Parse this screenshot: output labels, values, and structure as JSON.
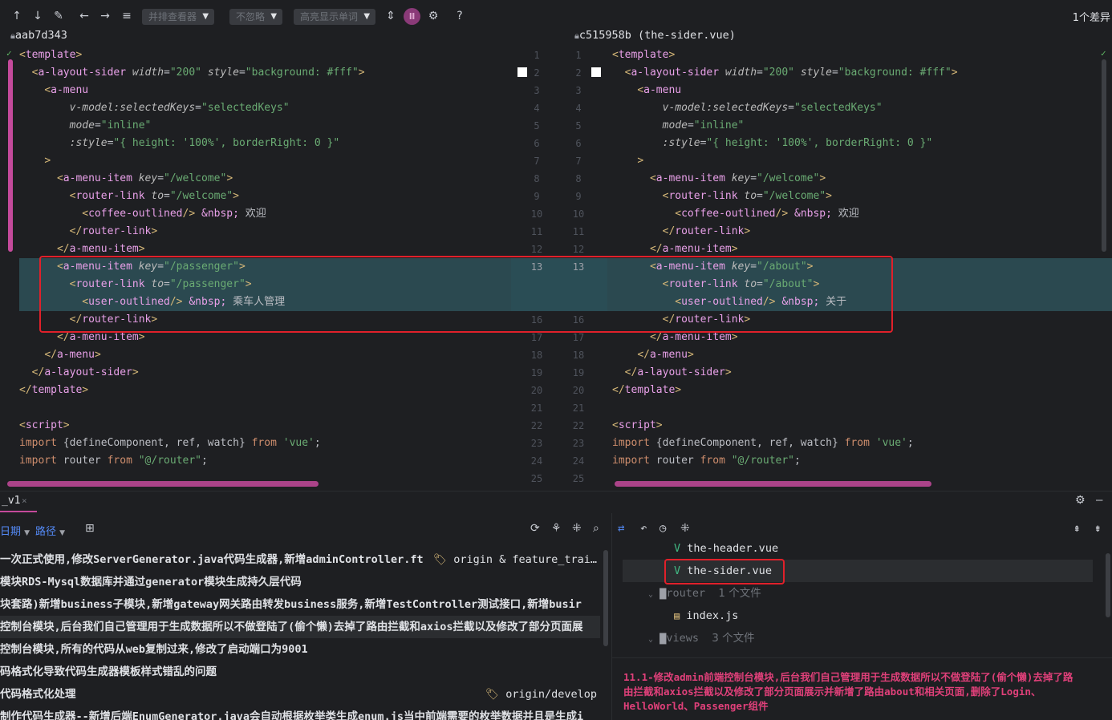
{
  "toolbar": {
    "viewer_label": "并排查看器",
    "ignore_label": "不忽略",
    "highlight_label": "高亮显示单词",
    "diff_count": "1个差异",
    "help": "?"
  },
  "left_panel": {
    "title": "aab7d343"
  },
  "right_panel": {
    "title": "c515958b (the-sider.vue)"
  },
  "code": {
    "left": [
      [
        "<template>"
      ],
      [
        "  <a-layout-sider width=\"200\" style=\"background: #fff\">"
      ],
      [
        "    <a-menu"
      ],
      [
        "        v-model:selectedKeys=\"selectedKeys\""
      ],
      [
        "        mode=\"inline\""
      ],
      [
        "        :style=\"{ height: '100%', borderRight: 0 }\""
      ],
      [
        "    >"
      ],
      [
        "      <a-menu-item key=\"/welcome\">"
      ],
      [
        "        <router-link to=\"/welcome\">"
      ],
      [
        "          <coffee-outlined/> &nbsp; 欢迎"
      ],
      [
        "        </router-link>"
      ],
      [
        "      </a-menu-item>"
      ],
      [
        "      <a-menu-item key=\"/passenger\">"
      ],
      [
        "        <router-link to=\"/passenger\">"
      ],
      [
        "          <user-outlined/> &nbsp; 乘车人管理"
      ],
      [
        "        </router-link>"
      ],
      [
        "      </a-menu-item>"
      ],
      [
        "    </a-menu>"
      ],
      [
        "  </a-layout-sider>"
      ],
      [
        "</template>"
      ],
      [
        ""
      ],
      [
        "<script>"
      ],
      [
        "import {defineComponent, ref, watch} from 'vue';"
      ],
      [
        "import router from \"@/router\";"
      ]
    ],
    "right_changed": [
      "      <a-menu-item key=\"/about\">",
      "        <router-link to=\"/about\">",
      "          <user-outlined/> &nbsp; 关于"
    ],
    "line_numbers_left": [
      "1",
      "2",
      "3",
      "4",
      "5",
      "6",
      "7",
      "8",
      "9",
      "10",
      "11",
      "12",
      "13",
      "",
      "",
      "16",
      "17",
      "18",
      "19",
      "20",
      "21",
      "22",
      "23",
      "24",
      "25"
    ],
    "line_numbers_right": [
      "1",
      "2",
      "3",
      "4",
      "5",
      "6",
      "7",
      "8",
      "9",
      "10",
      "11",
      "12",
      "13",
      "",
      "",
      "16",
      "17",
      "18",
      "19",
      "20",
      "21",
      "22",
      "23",
      "24",
      "25"
    ]
  },
  "bottom": {
    "tab_label": "_v1",
    "filter_date": "日期",
    "filter_path": "路径",
    "commits": [
      {
        "text": "一次正式使用,修改ServerGenerator.java代码生成器,新增adminController.ft",
        "ref": "origin & feature_trai…"
      },
      {
        "text": "模块RDS-Mysql数据库并通过generator模块生成持久层代码",
        "ref": ""
      },
      {
        "text": "块套路)新增business子模块,新增gateway网关路由转发business服务,新增TestController测试接口,新增busir",
        "ref": ""
      },
      {
        "text": "控制台模块,后台我们自己管理用于生成数据所以不做登陆了(偷个懒)去掉了路由拦截和axios拦截以及修改了部分页面展",
        "ref": ""
      },
      {
        "text": "控制台模块,所有的代码从web复制过来,修改了启动端口为9001",
        "ref": ""
      },
      {
        "text": "码格式化导致代码生成器模板样式错乱的问题",
        "ref": ""
      },
      {
        "text": "代码格式化处理",
        "ref": "origin/develop"
      },
      {
        "text": "制作代码生成器--新增后端EnumGenerator.java会自动根据枚举类生成enum.js当中前端需要的枚举数据并且是生成i",
        "ref": ""
      }
    ],
    "tree": {
      "prev_file": "the-header.vue",
      "selected_file": "the-sider.vue",
      "router_folder": "router",
      "router_count": "1 个文件",
      "index_file": "index.js",
      "views_folder": "views",
      "views_count": "3 个文件"
    },
    "commit_message": "11.1-修改admin前端控制台模块,后台我们自己管理用于生成数据所以不做登陆了(偷个懒)去掉了路由拦截和axios拦截以及修改了部分页面展示并新增了路由about和相关页面,删除了Login、HelloWorld、Passenger组件"
  },
  "colors": {
    "highlight_band": "#2b4950",
    "red_box": "#e0202a",
    "scroll_thumb": "#c44a9b",
    "commit_message": "#e0407a"
  }
}
